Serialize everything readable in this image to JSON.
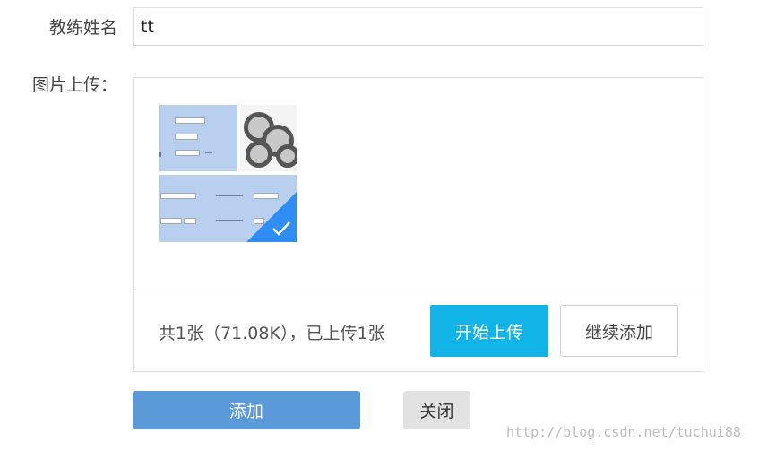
{
  "form": {
    "name_label": "教练姓名",
    "name_value": "tt",
    "upload_label": "图片上传："
  },
  "uploader": {
    "status_text": "共1张（71.08K），已上传1张",
    "start_button": "开始上传",
    "continue_button": "继续添加",
    "thumbnail_selected": true,
    "accent_color": "#2f8ef5"
  },
  "actions": {
    "add_button": "添加",
    "close_button": "关闭"
  },
  "watermark": "http://blog.csdn.net/tuchui88"
}
